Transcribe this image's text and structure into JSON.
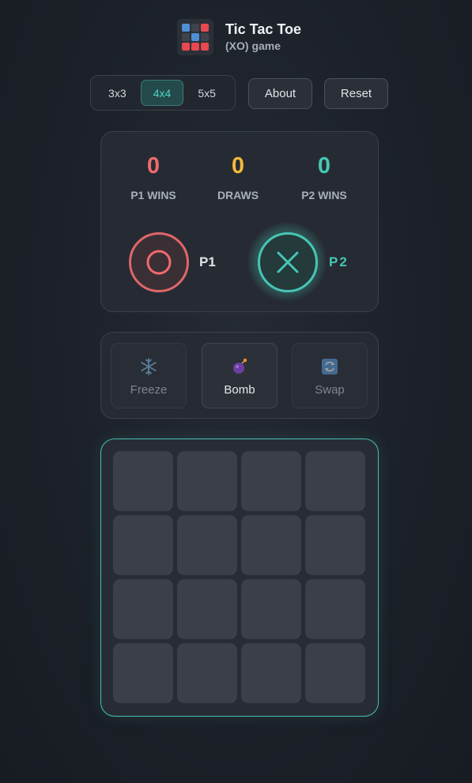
{
  "app": {
    "title": "Tic Tac Toe",
    "subtitle": "(XO) game",
    "logo_cells": [
      "#4f8fd6",
      "#3e434c",
      "#e8484f",
      "#3e434c",
      "#4f8fd6",
      "#3e434c",
      "#e8484f",
      "#e8484f",
      "#e8484f"
    ]
  },
  "sizes": [
    {
      "label": "3x3",
      "active": false
    },
    {
      "label": "4x4",
      "active": true
    },
    {
      "label": "5x5",
      "active": false
    }
  ],
  "buttons": {
    "about": "About",
    "reset": "Reset"
  },
  "scores": {
    "p1": {
      "value": "0",
      "label": "P1 WINS",
      "color": "#f06a6e"
    },
    "draws": {
      "value": "0",
      "label": "DRAWS",
      "color": "#f4b93a"
    },
    "p2": {
      "value": "0",
      "label": "P2 WINS",
      "color": "#46c6b4"
    }
  },
  "players": {
    "p1": {
      "label": "P1",
      "icon": "circle-o-icon",
      "color": "#f06a6e",
      "active": false
    },
    "p2": {
      "label": "P2",
      "icon": "x-cross-icon",
      "color": "#46c6b4",
      "active": true
    }
  },
  "powerups": [
    {
      "label": "Freeze",
      "icon": "snowflake-icon",
      "enabled": false
    },
    {
      "label": "Bomb",
      "icon": "bomb-icon",
      "enabled": true
    },
    {
      "label": "Swap",
      "icon": "swap-icon",
      "enabled": false
    }
  ],
  "board": {
    "size": 4,
    "cells": [
      "",
      "",
      "",
      "",
      "",
      "",
      "",
      "",
      "",
      "",
      "",
      "",
      "",
      "",
      "",
      ""
    ],
    "accent": "#47bfb1"
  }
}
